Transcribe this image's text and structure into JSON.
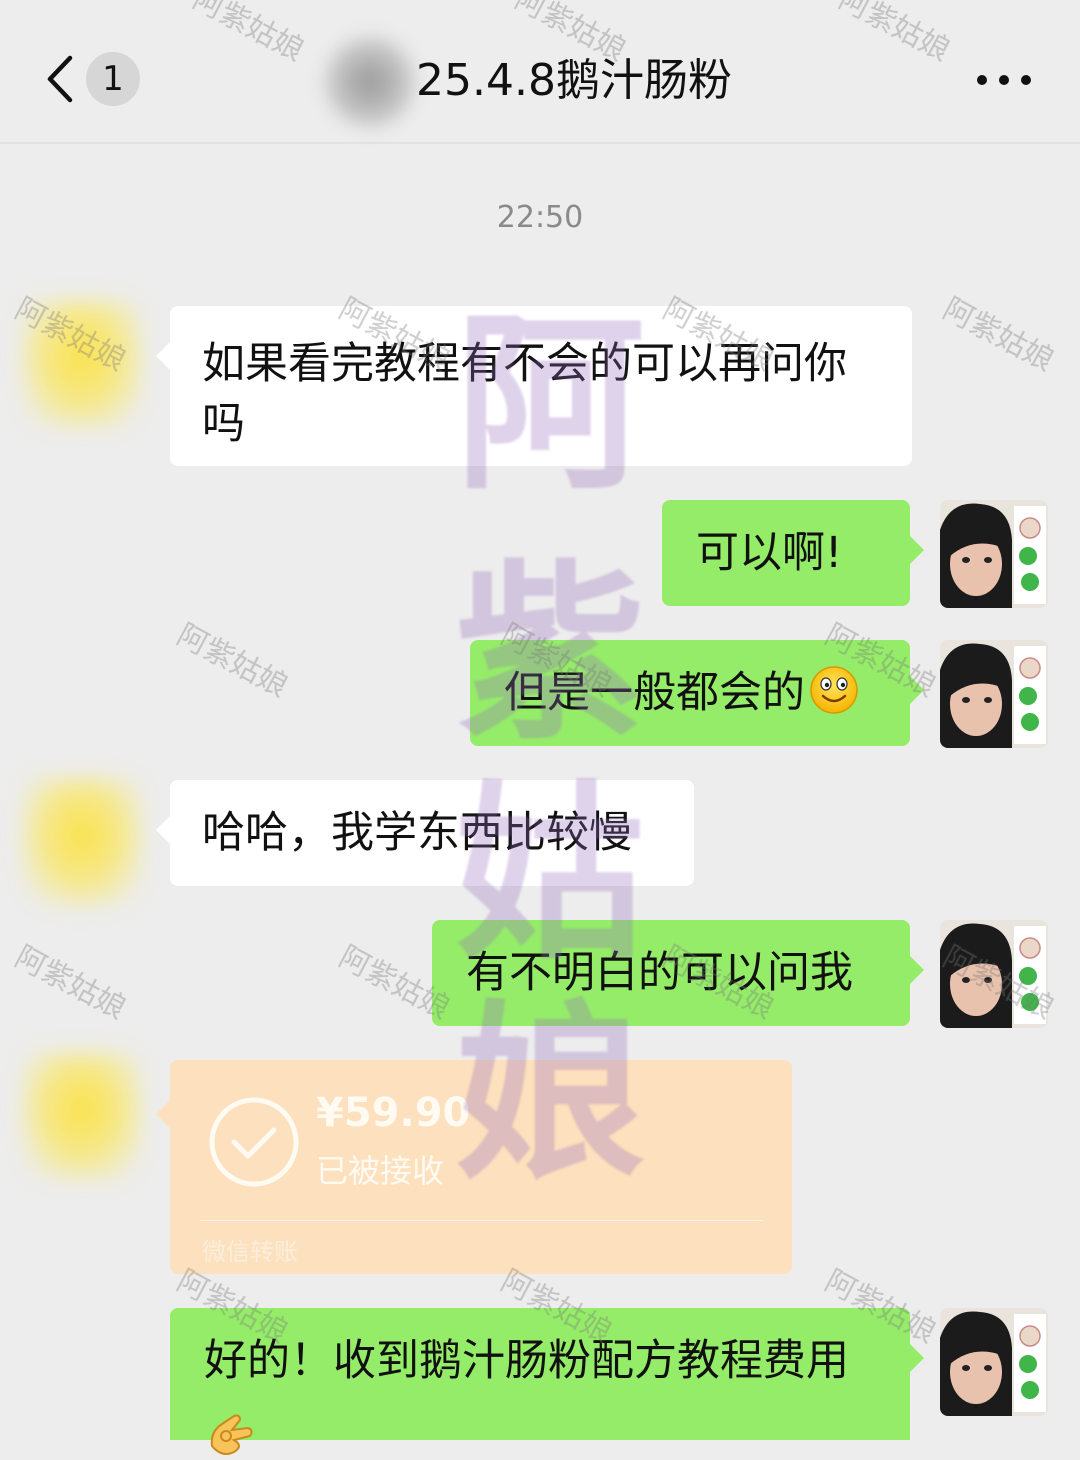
{
  "header": {
    "unread_count": "1",
    "title": "25.4.8鹅汁肠粉"
  },
  "chat": {
    "timestamp": "22:50",
    "messages": [
      {
        "side": "in",
        "text": "如果看完教程有不会的可以再问你吗"
      },
      {
        "side": "out",
        "text": "可以啊!"
      },
      {
        "side": "out",
        "text": "但是一般都会的"
      },
      {
        "side": "in",
        "text": "哈哈，我学东西比较慢"
      },
      {
        "side": "out",
        "text": "有不明白的可以问我"
      },
      {
        "side": "out",
        "text": "好的！收到鹅汁肠粉配方教程费用"
      }
    ],
    "transfer": {
      "amount": "¥59.90",
      "status": "已被接收",
      "type": "微信转账"
    }
  },
  "watermark": {
    "small": "阿紫姑娘",
    "big": [
      "阿",
      "紫",
      "姑",
      "娘"
    ]
  },
  "colors": {
    "background": "#ededed",
    "outgoing_bubble": "#95ec69",
    "incoming_bubble": "#ffffff",
    "transfer_card": "#fde0bd"
  }
}
